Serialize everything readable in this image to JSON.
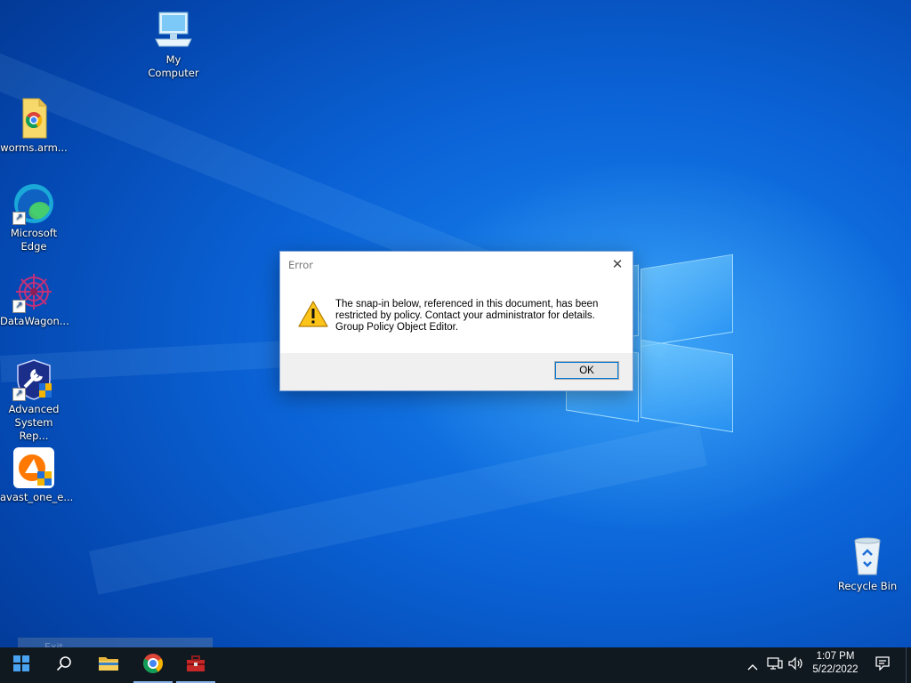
{
  "desktop": {
    "icons": [
      {
        "label": "My Computer",
        "icon": "monitor-icon"
      },
      {
        "label": "worms.arm...",
        "icon": "chrome-document-icon"
      },
      {
        "label": "Microsoft Edge",
        "icon": "edge-icon"
      },
      {
        "label": "DataWagon...",
        "icon": "datawagon-icon"
      },
      {
        "label": "Advanced System Rep...",
        "icon": "shield-wrench-icon"
      },
      {
        "label": "avast_one_e...",
        "icon": "avast-icon"
      },
      {
        "label": "Recycle Bin",
        "icon": "recycle-bin-icon"
      }
    ]
  },
  "dialog": {
    "title": "Error",
    "message_line1": "The snap-in below, referenced in this document, has been",
    "message_line2": "restricted by policy. Contact your administrator for details.",
    "message_line3": "Group Policy Object Editor.",
    "ok_label": "OK",
    "icon": "warning-icon"
  },
  "ghost_bar": {
    "label": "Exit"
  },
  "taskbar": {
    "apps": [
      "start-icon",
      "search-icon",
      "file-explorer-icon",
      "chrome-icon",
      "toolbox-icon"
    ],
    "tray": [
      "chevron-up-icon",
      "network-icon",
      "volume-icon",
      "notification-icon"
    ],
    "time": "1:07 PM",
    "date": "5/22/2022"
  },
  "colors": {
    "accent": "#0078d7",
    "taskbar": "#101820",
    "desktop": "#0b63d6"
  }
}
